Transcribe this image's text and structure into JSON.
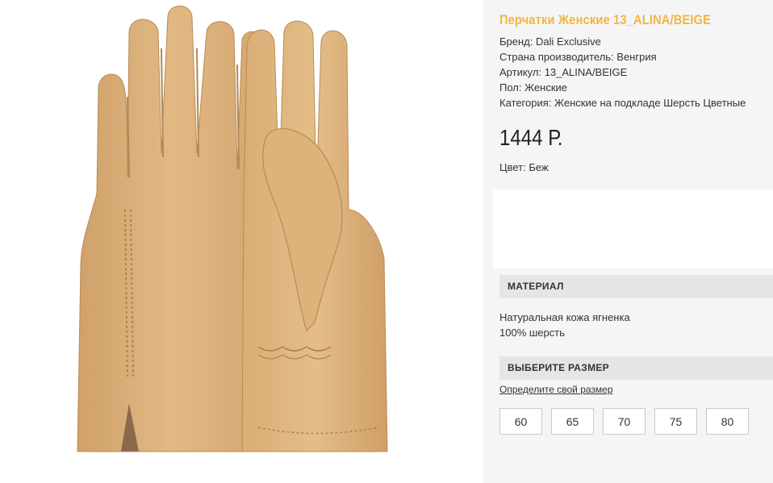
{
  "product": {
    "title": "Перчатки Женские 13_ALINA/BEIGE",
    "specs": [
      "Бренд: Dali Exclusive",
      "Страна производитель: Венгрия",
      "Артикул: 13_ALINA/BEIGE",
      "Пол: Женские",
      "Категория: Женские на подкладе Шерсть Цветные"
    ],
    "price": "1444 Р.",
    "color": "Цвет: Беж",
    "accent_color": "#f2b544",
    "glove_color": "#dfb57d"
  },
  "material": {
    "heading": "МАТЕРИАЛ",
    "lines": [
      "Натуральная кожа ягненка",
      "100% шерсть"
    ]
  },
  "size": {
    "heading": "ВЫБЕРИТЕ РАЗМЕР",
    "link": "Определите свой размер",
    "options": [
      "60",
      "65",
      "70",
      "75",
      "80"
    ]
  },
  "image": {
    "icon": "glove-pair-photo"
  }
}
